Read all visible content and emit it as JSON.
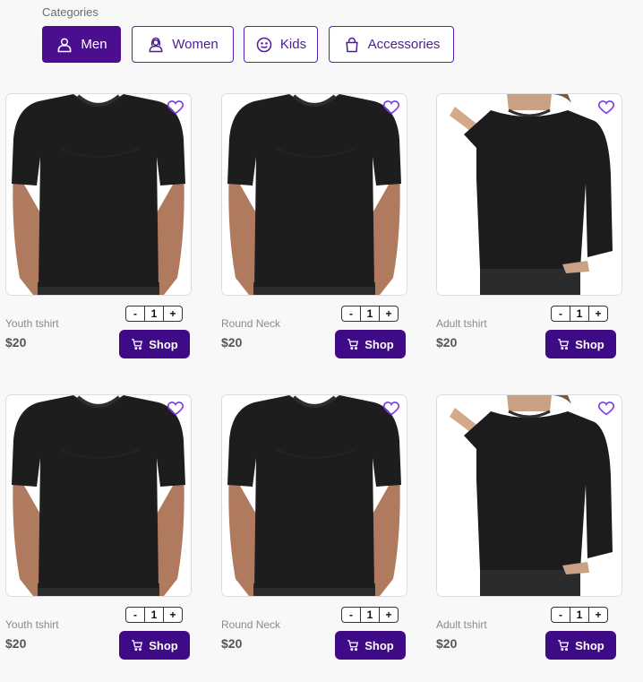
{
  "categories": {
    "title": "Categories",
    "items": [
      {
        "label": "Men",
        "icon": "person-icon",
        "active": true
      },
      {
        "label": "Women",
        "icon": "woman-icon",
        "active": false
      },
      {
        "label": "Kids",
        "icon": "smiley-icon",
        "active": false
      },
      {
        "label": "Accessories",
        "icon": "bag-icon",
        "active": false
      }
    ]
  },
  "products": [
    {
      "name": "Youth tshirt",
      "price": "$20",
      "qty": "1",
      "kind": "tshirt"
    },
    {
      "name": "Round Neck",
      "price": "$20",
      "qty": "1",
      "kind": "tshirt"
    },
    {
      "name": "Adult tshirt",
      "price": "$20",
      "qty": "1",
      "kind": "sweatshirt"
    },
    {
      "name": "Youth tshirt",
      "price": "$20",
      "qty": "1",
      "kind": "tshirt"
    },
    {
      "name": "Round Neck",
      "price": "$20",
      "qty": "1",
      "kind": "tshirt"
    },
    {
      "name": "Adult tshirt",
      "price": "$20",
      "qty": "1",
      "kind": "sweatshirt"
    }
  ],
  "stepper": {
    "minus": "-",
    "plus": "+"
  },
  "shop_label": "Shop",
  "colors": {
    "accent": "#4a0e8f",
    "shop": "#3f0a86",
    "heart": "#7c3aed"
  }
}
